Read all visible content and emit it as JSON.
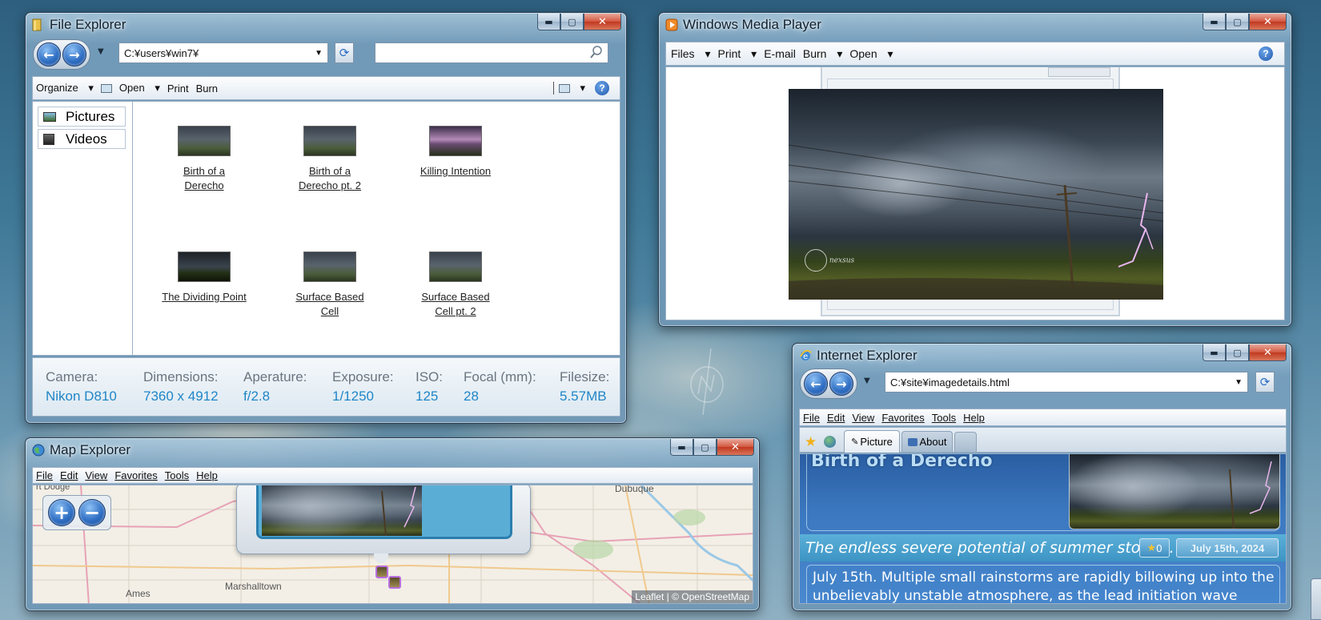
{
  "file_explorer": {
    "title": "File Explorer",
    "address": "C:¥users¥win7¥",
    "search_placeholder": "",
    "toolbar": {
      "organize": "Organize",
      "open": "Open",
      "print": "Print",
      "burn": "Burn"
    },
    "sidebar": [
      {
        "label": "Pictures",
        "icon": "pictures-icon"
      },
      {
        "label": "Videos",
        "icon": "videos-icon"
      }
    ],
    "files": [
      {
        "line1": "Birth of a",
        "line2": "Derecho",
        "thumb": "storm"
      },
      {
        "line1": "Birth of a",
        "line2": "Derecho pt. 2",
        "thumb": "storm"
      },
      {
        "line1": "Killing Intention",
        "line2": "",
        "thumb": "pink"
      },
      {
        "line1": "The Dividing Point",
        "line2": "",
        "thumb": "dark"
      },
      {
        "line1": "Surface Based",
        "line2": "Cell",
        "thumb": "storm"
      },
      {
        "line1": "Surface Based",
        "line2": "Cell pt. 2",
        "thumb": "storm"
      }
    ],
    "details": {
      "camera_label": "Camera:",
      "camera": "Nikon D810",
      "dimensions_label": "Dimensions:",
      "dimensions": "7360 x 4912",
      "aperture_label": "Aperature:",
      "aperture": "f/2.8",
      "exposure_label": "Exposure:",
      "exposure": "1/1250",
      "iso_label": "ISO:",
      "iso": "125",
      "focal_label": "Focal (mm):",
      "focal": "28",
      "filesize_label": "Filesize:",
      "filesize": "5.57MB"
    },
    "accent": "#1f86c7"
  },
  "media_player": {
    "title": "Windows Media Player",
    "menu": {
      "files": "Files",
      "print": "Print",
      "email": "E-mail",
      "burn": "Burn",
      "open": "Open"
    },
    "watermark": "nexsus"
  },
  "map_explorer": {
    "title": "Map Explorer",
    "menu": {
      "file": "File",
      "edit": "Edit",
      "view": "View",
      "favorites": "Favorites",
      "tools": "Tools",
      "help": "Help"
    },
    "zoom_in": "+",
    "zoom_out": "−",
    "places": {
      "dodge": "rt Dodge",
      "dubuque": "Dubuque",
      "marshalltown": "Marshalltown",
      "ames": "Ames"
    },
    "attribution_leaflet": "Leaflet",
    "attribution_sep": "|",
    "attribution_osm": "© OpenStreetMap"
  },
  "internet_explorer": {
    "title": "Internet Explorer",
    "address": "C:¥site¥imagedetails.html",
    "menu": {
      "file": "File",
      "edit": "Edit",
      "view": "View",
      "favorites": "Favorites",
      "tools": "Tools",
      "help": "Help"
    },
    "tabs": [
      {
        "label": "Picture"
      },
      {
        "label": "About"
      },
      {
        "label": ""
      }
    ],
    "page": {
      "heading": "Birth of a Derecho",
      "subtitle": "The endless severe potential of summer storms.",
      "star_count": "0",
      "date": "July 15th, 2024",
      "body": "July 15th. Multiple small rainstorms are rapidly billowing up into the unbelievably unstable atmosphere, as the lead initiation wave finally"
    },
    "heading_color": "#b9dcf5"
  }
}
